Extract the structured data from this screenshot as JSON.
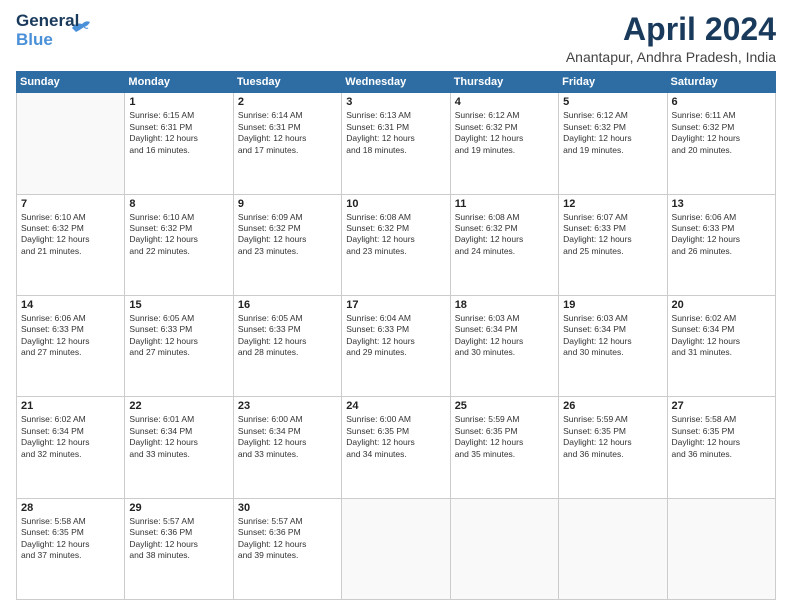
{
  "logo": {
    "line1": "General",
    "line2": "Blue"
  },
  "title": "April 2024",
  "location": "Anantapur, Andhra Pradesh, India",
  "days_header": [
    "Sunday",
    "Monday",
    "Tuesday",
    "Wednesday",
    "Thursday",
    "Friday",
    "Saturday"
  ],
  "weeks": [
    [
      {
        "day": "",
        "info": ""
      },
      {
        "day": "1",
        "info": "Sunrise: 6:15 AM\nSunset: 6:31 PM\nDaylight: 12 hours\nand 16 minutes."
      },
      {
        "day": "2",
        "info": "Sunrise: 6:14 AM\nSunset: 6:31 PM\nDaylight: 12 hours\nand 17 minutes."
      },
      {
        "day": "3",
        "info": "Sunrise: 6:13 AM\nSunset: 6:31 PM\nDaylight: 12 hours\nand 18 minutes."
      },
      {
        "day": "4",
        "info": "Sunrise: 6:12 AM\nSunset: 6:32 PM\nDaylight: 12 hours\nand 19 minutes."
      },
      {
        "day": "5",
        "info": "Sunrise: 6:12 AM\nSunset: 6:32 PM\nDaylight: 12 hours\nand 19 minutes."
      },
      {
        "day": "6",
        "info": "Sunrise: 6:11 AM\nSunset: 6:32 PM\nDaylight: 12 hours\nand 20 minutes."
      }
    ],
    [
      {
        "day": "7",
        "info": "Sunrise: 6:10 AM\nSunset: 6:32 PM\nDaylight: 12 hours\nand 21 minutes."
      },
      {
        "day": "8",
        "info": "Sunrise: 6:10 AM\nSunset: 6:32 PM\nDaylight: 12 hours\nand 22 minutes."
      },
      {
        "day": "9",
        "info": "Sunrise: 6:09 AM\nSunset: 6:32 PM\nDaylight: 12 hours\nand 23 minutes."
      },
      {
        "day": "10",
        "info": "Sunrise: 6:08 AM\nSunset: 6:32 PM\nDaylight: 12 hours\nand 23 minutes."
      },
      {
        "day": "11",
        "info": "Sunrise: 6:08 AM\nSunset: 6:32 PM\nDaylight: 12 hours\nand 24 minutes."
      },
      {
        "day": "12",
        "info": "Sunrise: 6:07 AM\nSunset: 6:33 PM\nDaylight: 12 hours\nand 25 minutes."
      },
      {
        "day": "13",
        "info": "Sunrise: 6:06 AM\nSunset: 6:33 PM\nDaylight: 12 hours\nand 26 minutes."
      }
    ],
    [
      {
        "day": "14",
        "info": "Sunrise: 6:06 AM\nSunset: 6:33 PM\nDaylight: 12 hours\nand 27 minutes."
      },
      {
        "day": "15",
        "info": "Sunrise: 6:05 AM\nSunset: 6:33 PM\nDaylight: 12 hours\nand 27 minutes."
      },
      {
        "day": "16",
        "info": "Sunrise: 6:05 AM\nSunset: 6:33 PM\nDaylight: 12 hours\nand 28 minutes."
      },
      {
        "day": "17",
        "info": "Sunrise: 6:04 AM\nSunset: 6:33 PM\nDaylight: 12 hours\nand 29 minutes."
      },
      {
        "day": "18",
        "info": "Sunrise: 6:03 AM\nSunset: 6:34 PM\nDaylight: 12 hours\nand 30 minutes."
      },
      {
        "day": "19",
        "info": "Sunrise: 6:03 AM\nSunset: 6:34 PM\nDaylight: 12 hours\nand 30 minutes."
      },
      {
        "day": "20",
        "info": "Sunrise: 6:02 AM\nSunset: 6:34 PM\nDaylight: 12 hours\nand 31 minutes."
      }
    ],
    [
      {
        "day": "21",
        "info": "Sunrise: 6:02 AM\nSunset: 6:34 PM\nDaylight: 12 hours\nand 32 minutes."
      },
      {
        "day": "22",
        "info": "Sunrise: 6:01 AM\nSunset: 6:34 PM\nDaylight: 12 hours\nand 33 minutes."
      },
      {
        "day": "23",
        "info": "Sunrise: 6:00 AM\nSunset: 6:34 PM\nDaylight: 12 hours\nand 33 minutes."
      },
      {
        "day": "24",
        "info": "Sunrise: 6:00 AM\nSunset: 6:35 PM\nDaylight: 12 hours\nand 34 minutes."
      },
      {
        "day": "25",
        "info": "Sunrise: 5:59 AM\nSunset: 6:35 PM\nDaylight: 12 hours\nand 35 minutes."
      },
      {
        "day": "26",
        "info": "Sunrise: 5:59 AM\nSunset: 6:35 PM\nDaylight: 12 hours\nand 36 minutes."
      },
      {
        "day": "27",
        "info": "Sunrise: 5:58 AM\nSunset: 6:35 PM\nDaylight: 12 hours\nand 36 minutes."
      }
    ],
    [
      {
        "day": "28",
        "info": "Sunrise: 5:58 AM\nSunset: 6:35 PM\nDaylight: 12 hours\nand 37 minutes."
      },
      {
        "day": "29",
        "info": "Sunrise: 5:57 AM\nSunset: 6:36 PM\nDaylight: 12 hours\nand 38 minutes."
      },
      {
        "day": "30",
        "info": "Sunrise: 5:57 AM\nSunset: 6:36 PM\nDaylight: 12 hours\nand 39 minutes."
      },
      {
        "day": "",
        "info": ""
      },
      {
        "day": "",
        "info": ""
      },
      {
        "day": "",
        "info": ""
      },
      {
        "day": "",
        "info": ""
      }
    ]
  ]
}
